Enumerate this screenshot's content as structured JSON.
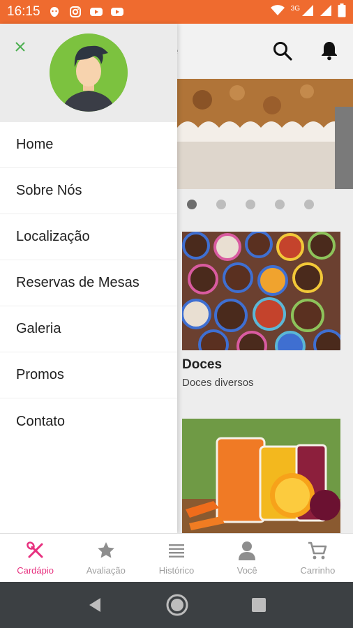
{
  "status_bar": {
    "time": "16:15",
    "network": "3G",
    "icons": [
      "bug-icon",
      "instagram-icon",
      "youtube-icon",
      "youtube-icon",
      "wifi-icon",
      "signal-icon",
      "signal-icon",
      "battery-icon"
    ]
  },
  "app": {
    "header_title_fragment": "e",
    "search_icon": "search-icon",
    "notification_icon": "bell-icon",
    "carousel": {
      "slides": 5,
      "active_index": 0
    },
    "categories": [
      {
        "title": "Doces",
        "subtitle": "Doces diversos"
      }
    ]
  },
  "drawer": {
    "close_icon": "close-icon",
    "menu": [
      "Home",
      "Sobre Nós",
      "Localização",
      "Reservas de Mesas",
      "Galeria",
      "Promos",
      "Contato"
    ]
  },
  "bottom_nav": {
    "items": [
      {
        "label": "Cardápio",
        "icon": "fork-knife-icon",
        "active": true
      },
      {
        "label": "Avaliação",
        "icon": "star-icon",
        "active": false
      },
      {
        "label": "Histórico",
        "icon": "list-icon",
        "active": false
      },
      {
        "label": "Você",
        "icon": "person-icon",
        "active": false
      },
      {
        "label": "Carrinho",
        "icon": "cart-icon",
        "active": false
      }
    ]
  },
  "colors": {
    "status_bar": "#ef6b2f",
    "accent": "#e7317f",
    "avatar_bg": "#7cc23f",
    "system_nav": "#3c4043"
  }
}
